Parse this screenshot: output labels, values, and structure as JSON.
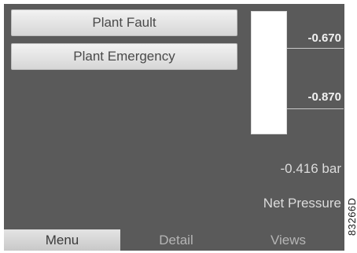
{
  "alarms": {
    "fault_label": "Plant Fault",
    "emergency_label": "Plant Emergency"
  },
  "gauge": {
    "scale_high": "-0.670",
    "scale_low": "-0.870",
    "bar_fill_fraction": 1.0
  },
  "reading": {
    "value": "-0.416 bar",
    "name": "Net Pressure"
  },
  "softkeys": {
    "menu": "Menu",
    "detail": "Detail",
    "views": "Views"
  },
  "figure_id": "83266D",
  "colors": {
    "screen_background": "#5a5a5a",
    "button_face": "#e0e0e0",
    "bar_fill": "#ffffff",
    "text_light": "#dcdcdc"
  }
}
